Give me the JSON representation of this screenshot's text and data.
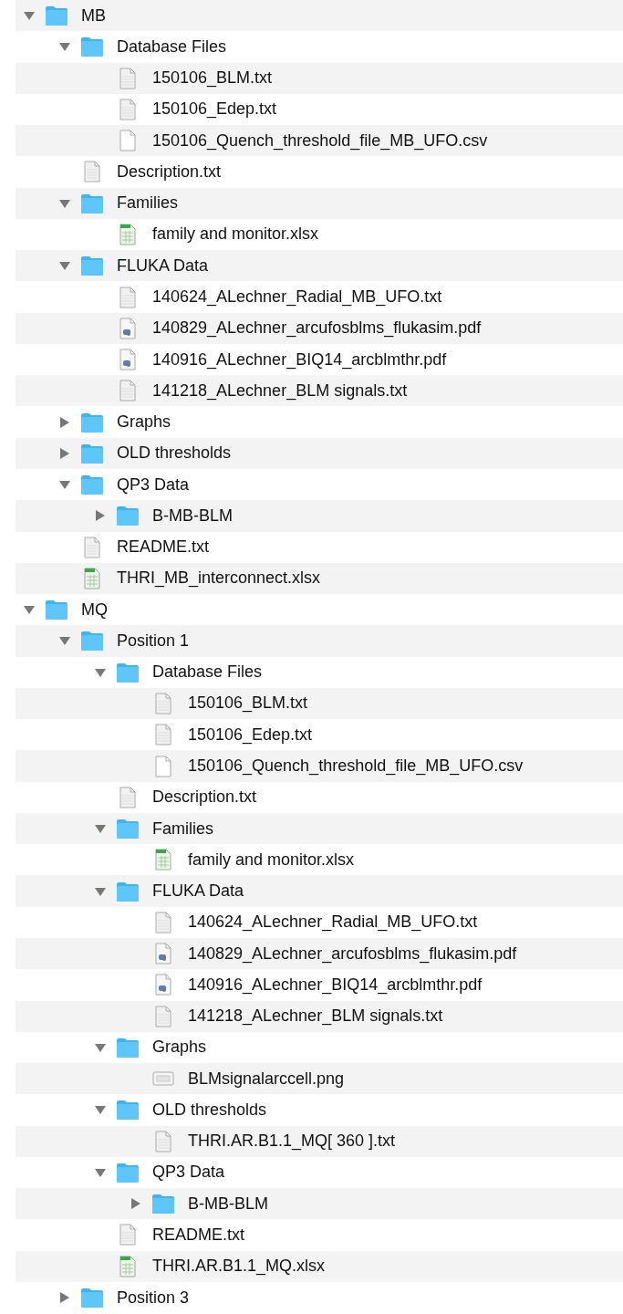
{
  "tree": [
    {
      "name": "MB",
      "kind": "folder",
      "expanded": true,
      "children": [
        {
          "name": "Database Files",
          "kind": "folder",
          "expanded": true,
          "children": [
            {
              "name": "150106_BLM.txt",
              "kind": "text"
            },
            {
              "name": "150106_Edep.txt",
              "kind": "text"
            },
            {
              "name": "150106_Quench_threshold_file_MB_UFO.csv",
              "kind": "blank"
            }
          ]
        },
        {
          "name": "Description.txt",
          "kind": "text"
        },
        {
          "name": "Families",
          "kind": "folder",
          "expanded": true,
          "children": [
            {
              "name": "family and monitor.xlsx",
              "kind": "sheet"
            }
          ]
        },
        {
          "name": "FLUKA Data",
          "kind": "folder",
          "expanded": true,
          "children": [
            {
              "name": "140624_ALechner_Radial_MB_UFO.txt",
              "kind": "text"
            },
            {
              "name": "140829_ALechner_arcufosblms_flukasim.pdf",
              "kind": "pdf"
            },
            {
              "name": "140916_ALechner_BIQ14_arcblmthr.pdf",
              "kind": "pdf"
            },
            {
              "name": "141218_ALechner_BLM signals.txt",
              "kind": "text"
            }
          ]
        },
        {
          "name": "Graphs",
          "kind": "folder",
          "expanded": false
        },
        {
          "name": "OLD thresholds",
          "kind": "folder",
          "expanded": false
        },
        {
          "name": "QP3 Data",
          "kind": "folder",
          "expanded": true,
          "children": [
            {
              "name": "B-MB-BLM",
              "kind": "folder",
              "expanded": false
            }
          ]
        },
        {
          "name": "README.txt",
          "kind": "text"
        },
        {
          "name": "THRI_MB_interconnect.xlsx",
          "kind": "sheet"
        }
      ]
    },
    {
      "name": "MQ",
      "kind": "folder",
      "expanded": true,
      "children": [
        {
          "name": "Position 1",
          "kind": "folder",
          "expanded": true,
          "children": [
            {
              "name": "Database Files",
              "kind": "folder",
              "expanded": true,
              "children": [
                {
                  "name": "150106_BLM.txt",
                  "kind": "text"
                },
                {
                  "name": "150106_Edep.txt",
                  "kind": "text"
                },
                {
                  "name": "150106_Quench_threshold_file_MB_UFO.csv",
                  "kind": "blank"
                }
              ]
            },
            {
              "name": "Description.txt",
              "kind": "text"
            },
            {
              "name": "Families",
              "kind": "folder",
              "expanded": true,
              "children": [
                {
                  "name": "family and monitor.xlsx",
                  "kind": "sheet"
                }
              ]
            },
            {
              "name": "FLUKA Data",
              "kind": "folder",
              "expanded": true,
              "children": [
                {
                  "name": "140624_ALechner_Radial_MB_UFO.txt",
                  "kind": "text"
                },
                {
                  "name": "140829_ALechner_arcufosblms_flukasim.pdf",
                  "kind": "pdf"
                },
                {
                  "name": "140916_ALechner_BIQ14_arcblmthr.pdf",
                  "kind": "pdf"
                },
                {
                  "name": "141218_ALechner_BLM signals.txt",
                  "kind": "text"
                }
              ]
            },
            {
              "name": "Graphs",
              "kind": "folder",
              "expanded": true,
              "children": [
                {
                  "name": "BLMsignalarccell.png",
                  "kind": "image"
                }
              ]
            },
            {
              "name": "OLD thresholds",
              "kind": "folder",
              "expanded": true,
              "children": [
                {
                  "name": "THRI.AR.B1.1_MQ[ 360 ].txt",
                  "kind": "text"
                }
              ]
            },
            {
              "name": "QP3 Data",
              "kind": "folder",
              "expanded": true,
              "children": [
                {
                  "name": "B-MB-BLM",
                  "kind": "folder",
                  "expanded": false
                }
              ]
            },
            {
              "name": "README.txt",
              "kind": "text"
            },
            {
              "name": "THRI.AR.B1.1_MQ.xlsx",
              "kind": "sheet"
            }
          ]
        },
        {
          "name": "Position 3",
          "kind": "folder",
          "expanded": false
        }
      ]
    }
  ]
}
